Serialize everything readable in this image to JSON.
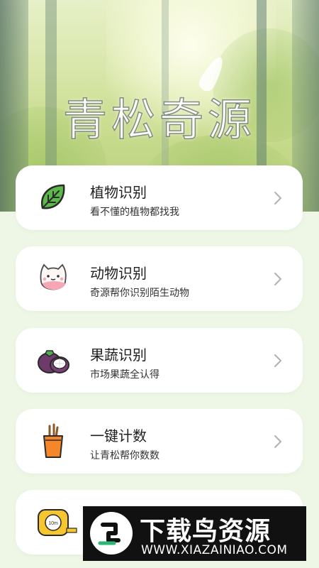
{
  "app": {
    "title": "青松奇源"
  },
  "menu": [
    {
      "label": "植物识别",
      "sub": "看不懂的植物都找我",
      "icon": "leaf-icon"
    },
    {
      "label": "动物识别",
      "sub": "奇源帮你识别陌生动物",
      "icon": "cat-icon"
    },
    {
      "label": "果蔬识别",
      "sub": "市场果蔬全认得",
      "icon": "mangosteen-icon"
    },
    {
      "label": "一键计数",
      "sub": "让青松帮你数数",
      "icon": "pencil-cup-icon"
    },
    {
      "label": "",
      "sub": "",
      "icon": "tape-measure-icon"
    }
  ],
  "watermark": {
    "title": "下载鸟资源",
    "url": "WWW.XIAZAINIAO.COM",
    "tape_text": "10m"
  },
  "colors": {
    "background": "#eef7e6",
    "card": "#ffffff",
    "leaf_green": "#5cb84a",
    "chevron": "#b0b0b0"
  }
}
